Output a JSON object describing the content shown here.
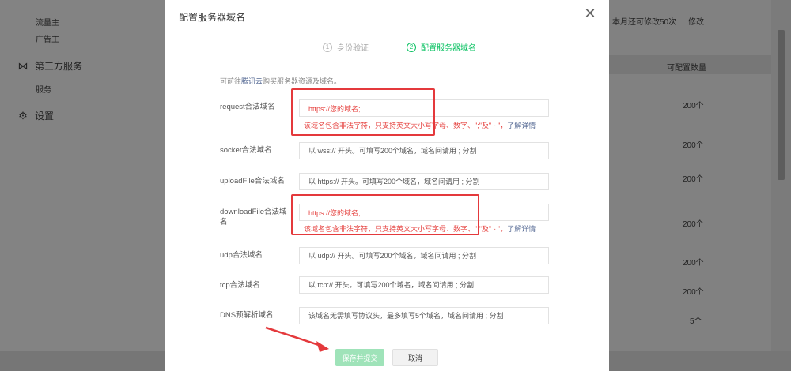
{
  "background": {
    "sidebar": {
      "items": [
        "流量主",
        "广告主"
      ],
      "group_third_party": "第三方服务",
      "service": "服务",
      "settings": "设置"
    },
    "right": {
      "quota_note": "本月还可修改50次",
      "modify_button": "修改",
      "column_header": "可配置数量",
      "counts": [
        "200个",
        "200个",
        "200个",
        "200个",
        "200个",
        "200个",
        "5个"
      ]
    }
  },
  "modal": {
    "title": "配置服务器域名",
    "steps": [
      {
        "num": "1",
        "label": "身份验证"
      },
      {
        "num": "2",
        "label": "配置服务器域名"
      }
    ],
    "intro_prefix": "可前往",
    "intro_link": "腾讯云",
    "intro_suffix": "购买服务器资源及域名。",
    "fields": [
      {
        "label": "request合法域名",
        "value": "https://您的域名;",
        "placeholder": "",
        "error": "该域名包含非法字符，只支持英文大小写字母、数字、\";\"及\" - \"，",
        "error_link": "了解详情"
      },
      {
        "label": "socket合法域名",
        "value": "",
        "placeholder": "以 wss:// 开头。可填写200个域名，域名间请用 ; 分割"
      },
      {
        "label": "uploadFile合法域名",
        "value": "",
        "placeholder": "以 https:// 开头。可填写200个域名，域名间请用 ; 分割"
      },
      {
        "label": "downloadFile合法域名",
        "value": "https://您的域名;",
        "placeholder": "",
        "error": "该域名包含非法字符，只支持英文大小写字母、数字、\";\"及\" - \"，",
        "error_link": "了解详情"
      },
      {
        "label": "udp合法域名",
        "value": "",
        "placeholder": "以 udp:// 开头。可填写200个域名，域名间请用 ; 分割"
      },
      {
        "label": "tcp合法域名",
        "value": "",
        "placeholder": "以 tcp:// 开头。可填写200个域名，域名间请用 ; 分割"
      },
      {
        "label": "DNS预解析域名",
        "value": "",
        "placeholder": "该域名无需填写协议头，最多填写5个域名，域名间请用 ; 分割"
      }
    ],
    "save_button": "保存并提交",
    "cancel_button": "取消"
  },
  "colors": {
    "accent_green": "#07c160",
    "error_red": "#e64340",
    "highlight_red": "#e4393c",
    "link_blue": "#576b95"
  }
}
